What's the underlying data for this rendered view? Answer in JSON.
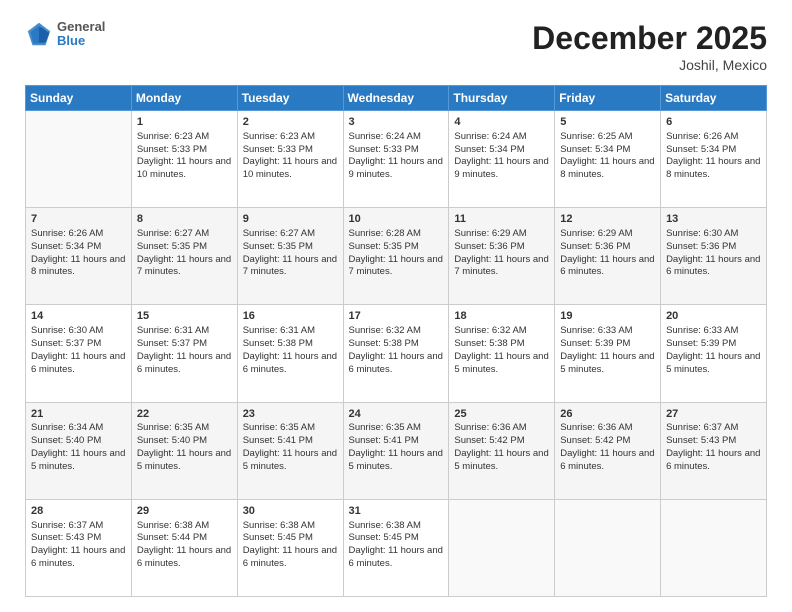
{
  "header": {
    "logo_general": "General",
    "logo_blue": "Blue",
    "title": "December 2025",
    "location": "Joshil, Mexico"
  },
  "days_of_week": [
    "Sunday",
    "Monday",
    "Tuesday",
    "Wednesday",
    "Thursday",
    "Friday",
    "Saturday"
  ],
  "weeks": [
    [
      {
        "day": "",
        "sunrise": "",
        "sunset": "",
        "daylight": "",
        "empty": true
      },
      {
        "day": "1",
        "sunrise": "Sunrise: 6:23 AM",
        "sunset": "Sunset: 5:33 PM",
        "daylight": "Daylight: 11 hours and 10 minutes."
      },
      {
        "day": "2",
        "sunrise": "Sunrise: 6:23 AM",
        "sunset": "Sunset: 5:33 PM",
        "daylight": "Daylight: 11 hours and 10 minutes."
      },
      {
        "day": "3",
        "sunrise": "Sunrise: 6:24 AM",
        "sunset": "Sunset: 5:33 PM",
        "daylight": "Daylight: 11 hours and 9 minutes."
      },
      {
        "day": "4",
        "sunrise": "Sunrise: 6:24 AM",
        "sunset": "Sunset: 5:34 PM",
        "daylight": "Daylight: 11 hours and 9 minutes."
      },
      {
        "day": "5",
        "sunrise": "Sunrise: 6:25 AM",
        "sunset": "Sunset: 5:34 PM",
        "daylight": "Daylight: 11 hours and 8 minutes."
      },
      {
        "day": "6",
        "sunrise": "Sunrise: 6:26 AM",
        "sunset": "Sunset: 5:34 PM",
        "daylight": "Daylight: 11 hours and 8 minutes."
      }
    ],
    [
      {
        "day": "7",
        "sunrise": "Sunrise: 6:26 AM",
        "sunset": "Sunset: 5:34 PM",
        "daylight": "Daylight: 11 hours and 8 minutes."
      },
      {
        "day": "8",
        "sunrise": "Sunrise: 6:27 AM",
        "sunset": "Sunset: 5:35 PM",
        "daylight": "Daylight: 11 hours and 7 minutes."
      },
      {
        "day": "9",
        "sunrise": "Sunrise: 6:27 AM",
        "sunset": "Sunset: 5:35 PM",
        "daylight": "Daylight: 11 hours and 7 minutes."
      },
      {
        "day": "10",
        "sunrise": "Sunrise: 6:28 AM",
        "sunset": "Sunset: 5:35 PM",
        "daylight": "Daylight: 11 hours and 7 minutes."
      },
      {
        "day": "11",
        "sunrise": "Sunrise: 6:29 AM",
        "sunset": "Sunset: 5:36 PM",
        "daylight": "Daylight: 11 hours and 7 minutes."
      },
      {
        "day": "12",
        "sunrise": "Sunrise: 6:29 AM",
        "sunset": "Sunset: 5:36 PM",
        "daylight": "Daylight: 11 hours and 6 minutes."
      },
      {
        "day": "13",
        "sunrise": "Sunrise: 6:30 AM",
        "sunset": "Sunset: 5:36 PM",
        "daylight": "Daylight: 11 hours and 6 minutes."
      }
    ],
    [
      {
        "day": "14",
        "sunrise": "Sunrise: 6:30 AM",
        "sunset": "Sunset: 5:37 PM",
        "daylight": "Daylight: 11 hours and 6 minutes."
      },
      {
        "day": "15",
        "sunrise": "Sunrise: 6:31 AM",
        "sunset": "Sunset: 5:37 PM",
        "daylight": "Daylight: 11 hours and 6 minutes."
      },
      {
        "day": "16",
        "sunrise": "Sunrise: 6:31 AM",
        "sunset": "Sunset: 5:38 PM",
        "daylight": "Daylight: 11 hours and 6 minutes."
      },
      {
        "day": "17",
        "sunrise": "Sunrise: 6:32 AM",
        "sunset": "Sunset: 5:38 PM",
        "daylight": "Daylight: 11 hours and 6 minutes."
      },
      {
        "day": "18",
        "sunrise": "Sunrise: 6:32 AM",
        "sunset": "Sunset: 5:38 PM",
        "daylight": "Daylight: 11 hours and 5 minutes."
      },
      {
        "day": "19",
        "sunrise": "Sunrise: 6:33 AM",
        "sunset": "Sunset: 5:39 PM",
        "daylight": "Daylight: 11 hours and 5 minutes."
      },
      {
        "day": "20",
        "sunrise": "Sunrise: 6:33 AM",
        "sunset": "Sunset: 5:39 PM",
        "daylight": "Daylight: 11 hours and 5 minutes."
      }
    ],
    [
      {
        "day": "21",
        "sunrise": "Sunrise: 6:34 AM",
        "sunset": "Sunset: 5:40 PM",
        "daylight": "Daylight: 11 hours and 5 minutes."
      },
      {
        "day": "22",
        "sunrise": "Sunrise: 6:35 AM",
        "sunset": "Sunset: 5:40 PM",
        "daylight": "Daylight: 11 hours and 5 minutes."
      },
      {
        "day": "23",
        "sunrise": "Sunrise: 6:35 AM",
        "sunset": "Sunset: 5:41 PM",
        "daylight": "Daylight: 11 hours and 5 minutes."
      },
      {
        "day": "24",
        "sunrise": "Sunrise: 6:35 AM",
        "sunset": "Sunset: 5:41 PM",
        "daylight": "Daylight: 11 hours and 5 minutes."
      },
      {
        "day": "25",
        "sunrise": "Sunrise: 6:36 AM",
        "sunset": "Sunset: 5:42 PM",
        "daylight": "Daylight: 11 hours and 5 minutes."
      },
      {
        "day": "26",
        "sunrise": "Sunrise: 6:36 AM",
        "sunset": "Sunset: 5:42 PM",
        "daylight": "Daylight: 11 hours and 6 minutes."
      },
      {
        "day": "27",
        "sunrise": "Sunrise: 6:37 AM",
        "sunset": "Sunset: 5:43 PM",
        "daylight": "Daylight: 11 hours and 6 minutes."
      }
    ],
    [
      {
        "day": "28",
        "sunrise": "Sunrise: 6:37 AM",
        "sunset": "Sunset: 5:43 PM",
        "daylight": "Daylight: 11 hours and 6 minutes."
      },
      {
        "day": "29",
        "sunrise": "Sunrise: 6:38 AM",
        "sunset": "Sunset: 5:44 PM",
        "daylight": "Daylight: 11 hours and 6 minutes."
      },
      {
        "day": "30",
        "sunrise": "Sunrise: 6:38 AM",
        "sunset": "Sunset: 5:45 PM",
        "daylight": "Daylight: 11 hours and 6 minutes."
      },
      {
        "day": "31",
        "sunrise": "Sunrise: 6:38 AM",
        "sunset": "Sunset: 5:45 PM",
        "daylight": "Daylight: 11 hours and 6 minutes."
      },
      {
        "day": "",
        "sunrise": "",
        "sunset": "",
        "daylight": "",
        "empty": true
      },
      {
        "day": "",
        "sunrise": "",
        "sunset": "",
        "daylight": "",
        "empty": true
      },
      {
        "day": "",
        "sunrise": "",
        "sunset": "",
        "daylight": "",
        "empty": true
      }
    ]
  ]
}
